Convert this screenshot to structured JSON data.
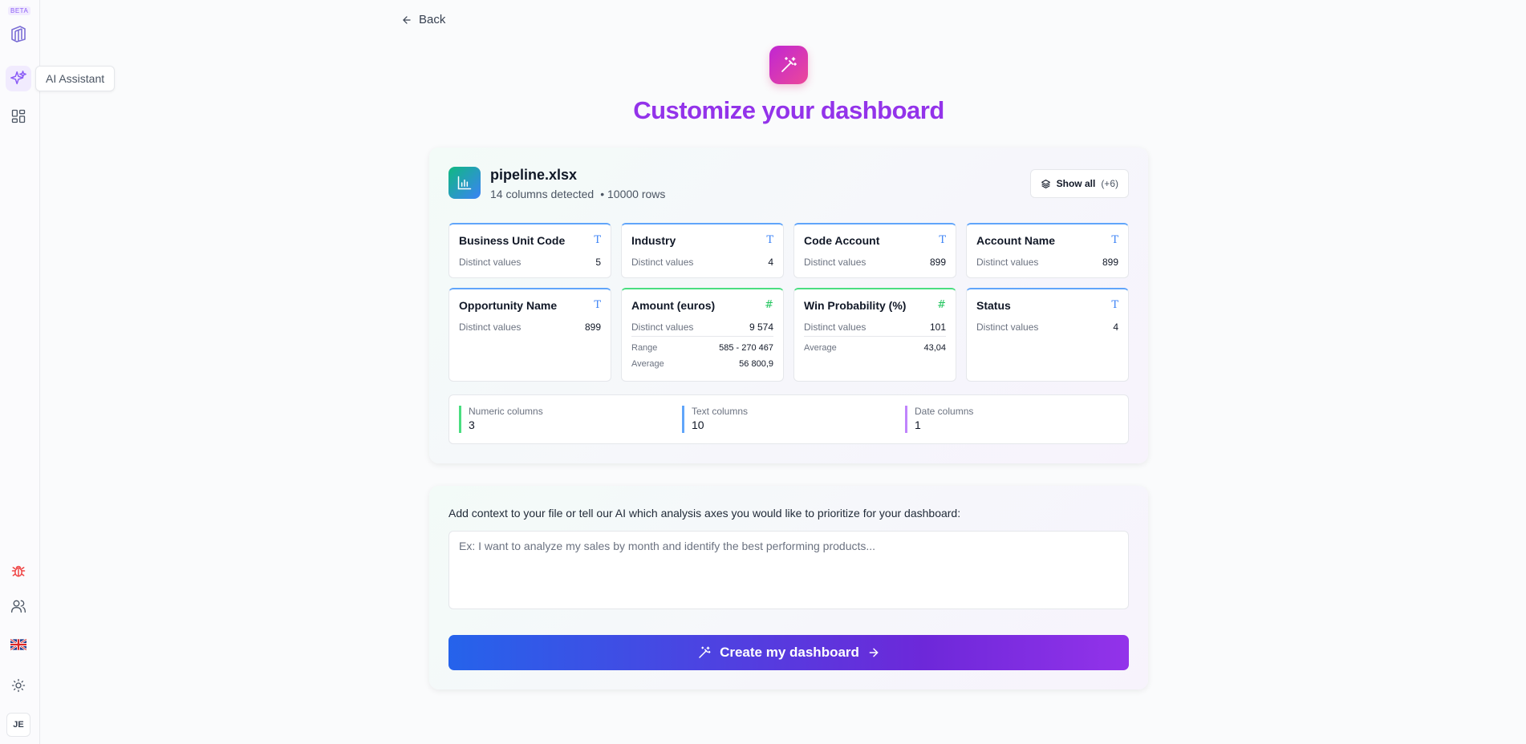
{
  "sidebar": {
    "beta": "BETA",
    "tooltip": "AI Assistant",
    "avatar": "JE"
  },
  "header": {
    "back_label": "Back",
    "title": "Customize your dashboard"
  },
  "file": {
    "name": "pipeline.xlsx",
    "columns_detected": "14 columns detected",
    "rows": "• 10000 rows",
    "show_all_label": "Show all",
    "show_all_count": "(+6)"
  },
  "columns": [
    {
      "name": "Business Unit Code",
      "type_icon": "T",
      "distinct_label": "Distinct values",
      "distinct": "5"
    },
    {
      "name": "Industry",
      "type_icon": "T",
      "distinct_label": "Distinct values",
      "distinct": "4"
    },
    {
      "name": "Code Account",
      "type_icon": "T",
      "distinct_label": "Distinct values",
      "distinct": "899"
    },
    {
      "name": "Account Name",
      "type_icon": "T",
      "distinct_label": "Distinct values",
      "distinct": "899"
    },
    {
      "name": "Opportunity Name",
      "type_icon": "T",
      "distinct_label": "Distinct values",
      "distinct": "899"
    },
    {
      "name": "Amount (euros)",
      "type_icon": "#",
      "distinct_label": "Distinct values",
      "distinct": "9 574",
      "range_label": "Range",
      "range": "585 - 270 467",
      "average_label": "Average",
      "average": "56 800,9"
    },
    {
      "name": "Win Probability (%)",
      "type_icon": "#",
      "distinct_label": "Distinct values",
      "distinct": "101",
      "average_label": "Average",
      "average": "43,04"
    },
    {
      "name": "Status",
      "type_icon": "T",
      "distinct_label": "Distinct values",
      "distinct": "4"
    }
  ],
  "summary": [
    {
      "label": "Numeric columns",
      "value": "3",
      "color": "#4ade80"
    },
    {
      "label": "Text columns",
      "value": "10",
      "color": "#60a5fa"
    },
    {
      "label": "Date columns",
      "value": "1",
      "color": "#c084fc"
    }
  ],
  "context": {
    "label": "Add context to your file or tell our AI which analysis axes you would like to prioritize for your dashboard:",
    "placeholder": "Ex: I want to analyze my sales by month and identify the best performing products...",
    "value": ""
  },
  "cta": {
    "label": "Create my dashboard"
  },
  "colors": {
    "accent": "#9333ea",
    "text_type": "#3b82f6",
    "numeric_type": "#22c55e",
    "debug_icon": "#ef4444"
  }
}
